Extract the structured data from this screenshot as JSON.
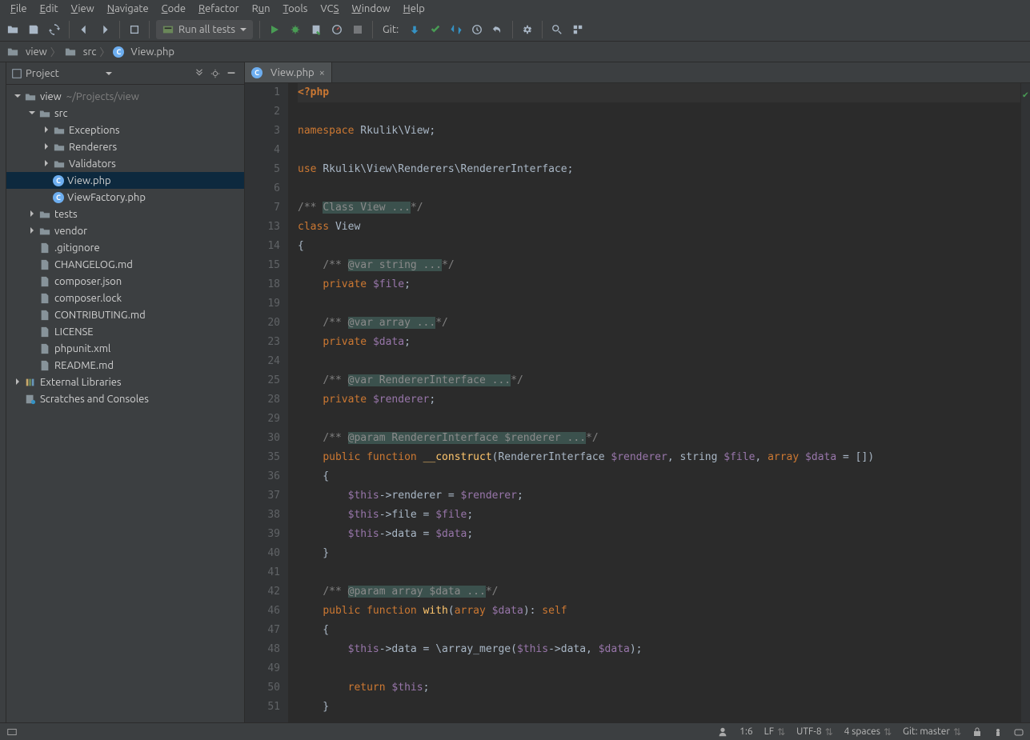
{
  "menu": [
    "File",
    "Edit",
    "View",
    "Navigate",
    "Code",
    "Refactor",
    "Run",
    "Tools",
    "VCS",
    "Window",
    "Help"
  ],
  "menu_ul": [
    "F",
    "E",
    "V",
    "N",
    "C",
    "R",
    "u",
    "T",
    "S",
    "W",
    "H"
  ],
  "run_config": "Run all tests",
  "git_label": "Git:",
  "breadcrumb": {
    "root": "view",
    "mid": "src",
    "file": "View.php"
  },
  "project": {
    "title": "Project",
    "root": {
      "name": "view",
      "path": "~/Projects/view"
    },
    "tree": [
      {
        "depth": 0,
        "arrow": "down",
        "icon": "folder",
        "label": "view",
        "suffix": "~/Projects/view"
      },
      {
        "depth": 1,
        "arrow": "down",
        "icon": "folder",
        "label": "src"
      },
      {
        "depth": 2,
        "arrow": "right",
        "icon": "folder",
        "label": "Exceptions"
      },
      {
        "depth": 2,
        "arrow": "right",
        "icon": "folder",
        "label": "Renderers"
      },
      {
        "depth": 2,
        "arrow": "right",
        "icon": "folder",
        "label": "Validators"
      },
      {
        "depth": 2,
        "arrow": "none",
        "icon": "php",
        "label": "View.php",
        "active": true
      },
      {
        "depth": 2,
        "arrow": "none",
        "icon": "php",
        "label": "ViewFactory.php"
      },
      {
        "depth": 1,
        "arrow": "right",
        "icon": "folder",
        "label": "tests"
      },
      {
        "depth": 1,
        "arrow": "right",
        "icon": "folder",
        "label": "vendor"
      },
      {
        "depth": 1,
        "arrow": "none",
        "icon": "file",
        "label": ".gitignore"
      },
      {
        "depth": 1,
        "arrow": "none",
        "icon": "file",
        "label": "CHANGELOG.md"
      },
      {
        "depth": 1,
        "arrow": "none",
        "icon": "file",
        "label": "composer.json"
      },
      {
        "depth": 1,
        "arrow": "none",
        "icon": "file",
        "label": "composer.lock"
      },
      {
        "depth": 1,
        "arrow": "none",
        "icon": "file",
        "label": "CONTRIBUTING.md"
      },
      {
        "depth": 1,
        "arrow": "none",
        "icon": "file",
        "label": "LICENSE"
      },
      {
        "depth": 1,
        "arrow": "none",
        "icon": "file",
        "label": "phpunit.xml"
      },
      {
        "depth": 1,
        "arrow": "none",
        "icon": "file",
        "label": "README.md"
      },
      {
        "depth": 0,
        "arrow": "right",
        "icon": "lib",
        "label": "External Libraries"
      },
      {
        "depth": 0,
        "arrow": "none",
        "icon": "scratch",
        "label": "Scratches and Consoles"
      }
    ]
  },
  "tab": {
    "name": "View.php"
  },
  "code": {
    "lines": [
      {
        "n": 1,
        "html": "<span class='tk-tag'>&lt;?php</span>",
        "hl": true
      },
      {
        "n": 2,
        "html": ""
      },
      {
        "n": 3,
        "html": "<span class='tk-kw'>namespace</span> <span class='tk-ns'>Rkulik\\View</span>;"
      },
      {
        "n": 4,
        "html": ""
      },
      {
        "n": 5,
        "html": "<span class='tk-kw'>use</span> <span class='tk-ns'>Rkulik\\View\\Renderers\\RendererInterface</span>;"
      },
      {
        "n": 6,
        "html": ""
      },
      {
        "n": 7,
        "html": "<span class='tk-cm'>/**</span> <span class='tk-cm-fold'>Class View ...</span><span class='tk-cm'>*/</span>"
      },
      {
        "n": 13,
        "html": "<span class='tk-kw'>class</span> <span class='tk-type'>View</span>"
      },
      {
        "n": 14,
        "html": "{"
      },
      {
        "n": 15,
        "html": "    <span class='tk-cm'>/**</span> <span class='tk-cm-fold'>@var string ...</span><span class='tk-cm'>*/</span>"
      },
      {
        "n": 18,
        "html": "    <span class='tk-kw'>private</span> <span class='tk-var'>$file</span>;"
      },
      {
        "n": 19,
        "html": ""
      },
      {
        "n": 20,
        "html": "    <span class='tk-cm'>/**</span> <span class='tk-cm-fold'>@var array ...</span><span class='tk-cm'>*/</span>"
      },
      {
        "n": 23,
        "html": "    <span class='tk-kw'>private</span> <span class='tk-var'>$data</span>;"
      },
      {
        "n": 24,
        "html": ""
      },
      {
        "n": 25,
        "html": "    <span class='tk-cm'>/**</span> <span class='tk-cm-fold'>@var RendererInterface ...</span><span class='tk-cm'>*/</span>"
      },
      {
        "n": 28,
        "html": "    <span class='tk-kw'>private</span> <span class='tk-var'>$renderer</span>;"
      },
      {
        "n": 29,
        "html": ""
      },
      {
        "n": 30,
        "html": "    <span class='tk-cm'>/**</span> <span class='tk-cm-fold'>@param RendererInterface $renderer ...</span><span class='tk-cm'>*/</span>"
      },
      {
        "n": 35,
        "html": "    <span class='tk-kw'>public</span> <span class='tk-kw'>function</span> <span class='tk-fn'>__construct</span>(RendererInterface <span class='tk-var'>$renderer</span>, string <span class='tk-var'>$file</span>, <span class='tk-kw'>array</span> <span class='tk-var'>$data</span> = [])"
      },
      {
        "n": 36,
        "html": "    {"
      },
      {
        "n": 37,
        "html": "        <span class='tk-var'>$this</span>-&gt;renderer = <span class='tk-var'>$renderer</span>;"
      },
      {
        "n": 38,
        "html": "        <span class='tk-var'>$this</span>-&gt;file = <span class='tk-var'>$file</span>;"
      },
      {
        "n": 39,
        "html": "        <span class='tk-var'>$this</span>-&gt;data = <span class='tk-var'>$data</span>;"
      },
      {
        "n": 40,
        "html": "    }"
      },
      {
        "n": 41,
        "html": ""
      },
      {
        "n": 42,
        "html": "    <span class='tk-cm'>/**</span> <span class='tk-cm-fold'>@param array $data ...</span><span class='tk-cm'>*/</span>"
      },
      {
        "n": 46,
        "html": "    <span class='tk-kw'>public</span> <span class='tk-kw'>function</span> <span class='tk-fn'>with</span>(<span class='tk-kw'>array</span> <span class='tk-var'>$data</span>): <span class='tk-kw'>self</span>"
      },
      {
        "n": 47,
        "html": "    {"
      },
      {
        "n": 48,
        "html": "        <span class='tk-var'>$this</span>-&gt;data = \\array_merge(<span class='tk-var'>$this</span>-&gt;data, <span class='tk-var'>$data</span>);"
      },
      {
        "n": 49,
        "html": ""
      },
      {
        "n": 50,
        "html": "        <span class='tk-kw'>return</span> <span class='tk-var'>$this</span>;"
      },
      {
        "n": 51,
        "html": "    }"
      }
    ]
  },
  "status": {
    "pos": "1:6",
    "eol": "LF",
    "enc": "UTF-8",
    "indent": "4 spaces",
    "git": "Git: master"
  }
}
